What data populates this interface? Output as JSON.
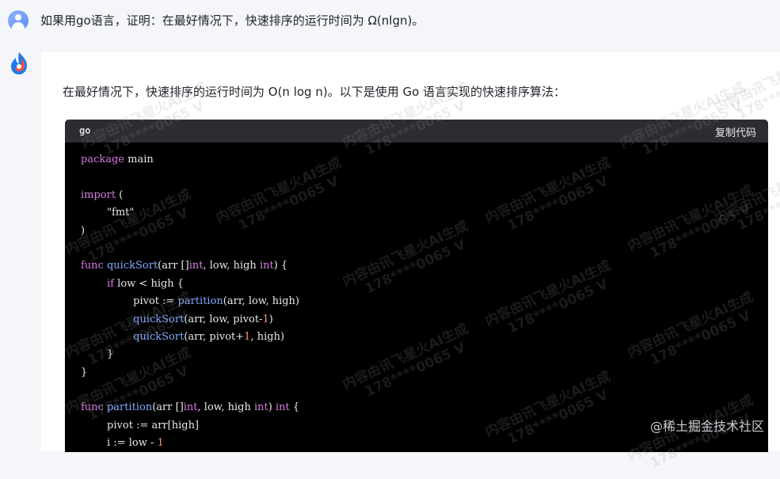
{
  "question": {
    "text": "如果用go语言，证明：在最好情况下，快速排序的运行时间为 Ω(nlgn)。"
  },
  "answer": {
    "intro": "在最好情况下，快速排序的运行时间为 O(n log n)。以下是使用 Go 语言实现的快速排序算法："
  },
  "code": {
    "language": "go",
    "copy_label": "复制代码",
    "lines": [
      "package main",
      "",
      "import (",
      "        \"fmt\"",
      ")",
      "",
      "func quickSort(arr []int, low, high int) {",
      "        if low < high {",
      "                pivot := partition(arr, low, high)",
      "                quickSort(arr, low, pivot-1)",
      "                quickSort(arr, pivot+1, high)",
      "        }",
      "}",
      "",
      "func partition(arr []int, low, high int) int {",
      "        pivot := arr[high]",
      "        i := low - 1"
    ]
  },
  "watermark": {
    "line1": "内容由讯飞星火AI生成",
    "line2": "178****0065 V"
  },
  "site_mark": "@稀土掘金技术社区",
  "colors": {
    "page_bg": "#f4f6f9",
    "code_bg": "#000000",
    "code_header_bg": "#2b2d31",
    "keyword": "#d67be0",
    "function": "#82aaff",
    "number": "#f78c6c"
  }
}
